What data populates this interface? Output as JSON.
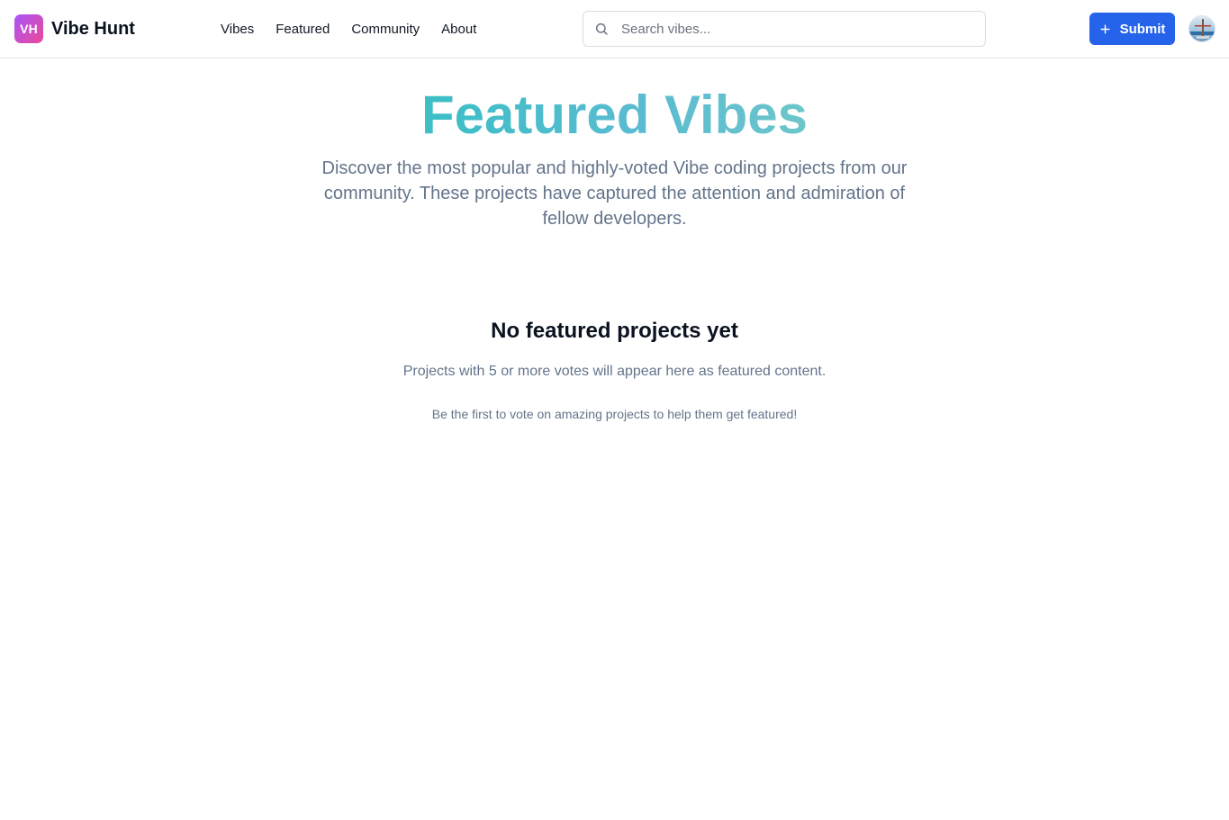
{
  "brand": {
    "logo_initials": "VH",
    "name": "Vibe Hunt",
    "gradient_colors": [
      "#a855f7",
      "#ec4899"
    ]
  },
  "nav": {
    "items": [
      {
        "label": "Vibes"
      },
      {
        "label": "Featured"
      },
      {
        "label": "Community"
      },
      {
        "label": "About"
      }
    ]
  },
  "search": {
    "placeholder": "Search vibes...",
    "value": "",
    "icon": "search-icon"
  },
  "actions": {
    "submit_label": "Submit",
    "submit_icon": "plus-icon",
    "submit_color": "#2563eb"
  },
  "user": {
    "avatar_icon": "avatar"
  },
  "hero": {
    "title": "Featured Vibes",
    "subtitle": "Discover the most popular and highly-voted Vibe coding projects from our community. These projects have captured the attention and admiration of fellow developers.",
    "title_gradient": [
      "#3bbfc6",
      "#6cc6c9"
    ]
  },
  "empty_state": {
    "title": "No featured projects yet",
    "description": "Projects with 5 or more votes will appear here as featured content.",
    "hint": "Be the first to vote on amazing projects to help them get featured!"
  }
}
